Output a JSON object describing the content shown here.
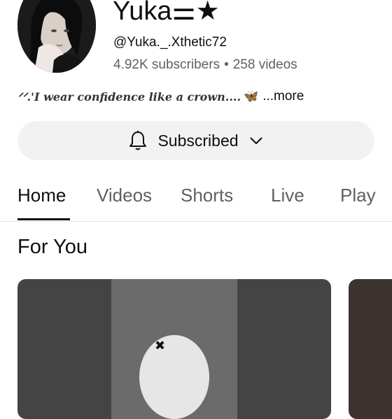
{
  "channel": {
    "name": "Yuka",
    "name_symbols": "⚌★",
    "handle": "@Yuka._.Xthetic72",
    "subscribers": "4.92K subscribers",
    "separator": "•",
    "videos": "258 videos",
    "description_prefix": "ᐟᐟ.",
    "description": "'I wear confidence like a crown....",
    "description_emoji": "🦋",
    "more_label": "...more"
  },
  "subscribe": {
    "label": "Subscribed",
    "bell_icon": "bell-icon",
    "chevron_icon": "chevron-down-icon"
  },
  "tabs": [
    {
      "label": "Home",
      "active": true
    },
    {
      "label": "Videos",
      "active": false
    },
    {
      "label": "Shorts",
      "active": false
    },
    {
      "label": "Live",
      "active": false
    },
    {
      "label": "Play",
      "active": false
    }
  ],
  "section": {
    "title": "For You"
  },
  "colors": {
    "text_primary": "#0f0f0f",
    "text_secondary": "#606060",
    "button_bg": "#f2f2f2"
  }
}
